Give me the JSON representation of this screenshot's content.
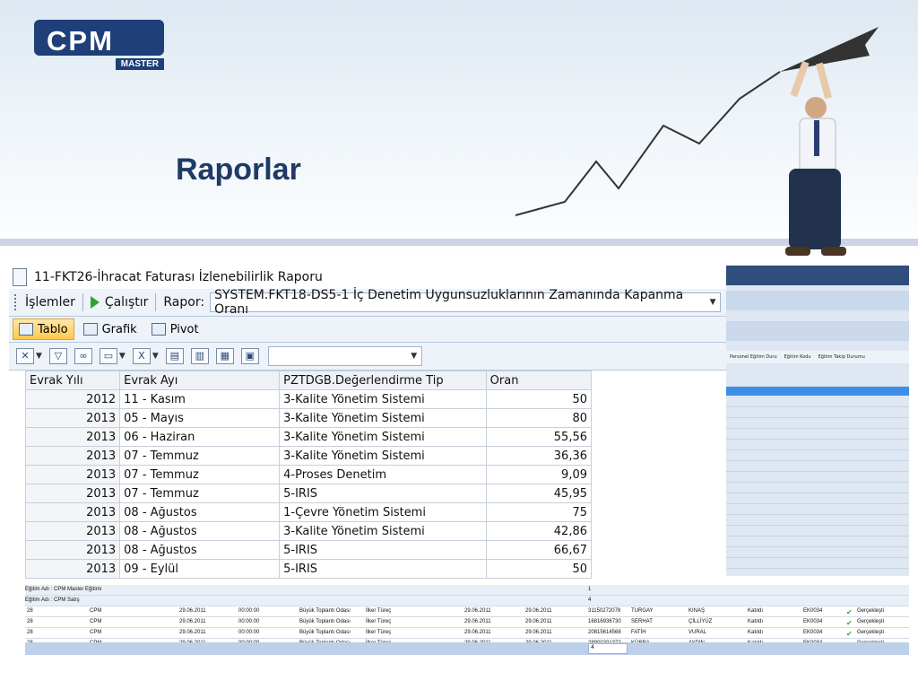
{
  "slide": {
    "logo_text": "CPM",
    "logo_sub": "MASTER",
    "title": "Raporlar"
  },
  "window": {
    "title": "11-FKT26-İhracat Faturası İzlenebilirlik Raporu"
  },
  "toolbar1": {
    "islemler": "İşlemler",
    "calistir": "Çalıştır",
    "rapor_label": "Rapor:",
    "rapor_value": "SYSTEM.FKT18-DS5-1 İç Denetim Uygunsuzluklarının Zamanında Kapanma Oranı"
  },
  "toolbar2": {
    "tabs": [
      "Tablo",
      "Grafik",
      "Pivot"
    ],
    "active_tab": "Tablo"
  },
  "pivot": {
    "headers": [
      "Evrak Yılı",
      "Evrak Ayı",
      "PZTDGB.Değerlendirme Tip",
      "Oran"
    ],
    "rows": [
      [
        "2012",
        "11 - Kasım",
        "3-Kalite Yönetim Sistemi",
        "50"
      ],
      [
        "2013",
        "05 - Mayıs",
        "3-Kalite Yönetim Sistemi",
        "80"
      ],
      [
        "2013",
        "06 - Haziran",
        "3-Kalite Yönetim Sistemi",
        "55,56"
      ],
      [
        "2013",
        "07 - Temmuz",
        "3-Kalite Yönetim Sistemi",
        "36,36"
      ],
      [
        "2013",
        "07 - Temmuz",
        "4-Proses Denetim",
        "9,09"
      ],
      [
        "2013",
        "07 - Temmuz",
        "5-IRIS",
        "45,95"
      ],
      [
        "2013",
        "08 - Ağustos",
        "1-Çevre Yönetim Sistemi",
        "75"
      ],
      [
        "2013",
        "08 - Ağustos",
        "3-Kalite Yönetim Sistemi",
        "42,86"
      ],
      [
        "2013",
        "08 - Ağustos",
        "5-IRIS",
        "66,67"
      ],
      [
        "2013",
        "09 - Eylül",
        "5-IRIS",
        "50"
      ]
    ]
  },
  "right_headers": [
    "Personel Eğitim Duru",
    "Eğitim Kodu",
    "Eğitim Takip Durumu"
  ],
  "detail": {
    "group1": "Eğitim Adı : CPM Master Eğitimi",
    "group1_count": "1",
    "group2": "Eğitim Adı : CPM Satış",
    "group2_count": "4",
    "rows": [
      [
        "28",
        "CPM",
        "29.06.2011",
        "00:00:00",
        "Büyük Toplantı Odası",
        "İlker Türeç",
        "29.06.2011",
        "29.06.2011",
        "31150272078",
        "TURGAY",
        "KINAŞ",
        "Katıldı",
        "EK0034",
        "Gerçekleşti"
      ],
      [
        "28",
        "CPM",
        "29.06.2011",
        "00:00:00",
        "Büyük Toplantı Odası",
        "İlker Türeç",
        "29.06.2011",
        "29.06.2011",
        "16816936730",
        "SERHAT",
        "ÇİLLİYÜZ",
        "Katıldı",
        "EK0034",
        "Gerçekleşti"
      ],
      [
        "28",
        "CPM",
        "29.06.2011",
        "00:00:00",
        "Büyük Toplantı Odası",
        "İlker Türeç",
        "29.06.2011",
        "29.06.2011",
        "20815614568",
        "FATİH",
        "VURAL",
        "Katıldı",
        "EK0034",
        "Gerçekleşti"
      ],
      [
        "28",
        "CPM",
        "29.06.2011",
        "00:00:00",
        "Büyük Toplantı Odası",
        "İlker Türeç",
        "29.06.2011",
        "29.06.2011",
        "28900201372",
        "KÜBRA",
        "AYDIN",
        "Katıldı",
        "EK0034",
        "Gerçekleşti"
      ]
    ],
    "footer_count": "4"
  },
  "colors": {
    "title": "#1f3a66",
    "logo": "#1e3f78",
    "active_tab": "#ffc94d",
    "selected_row": "#3d8ee6"
  }
}
